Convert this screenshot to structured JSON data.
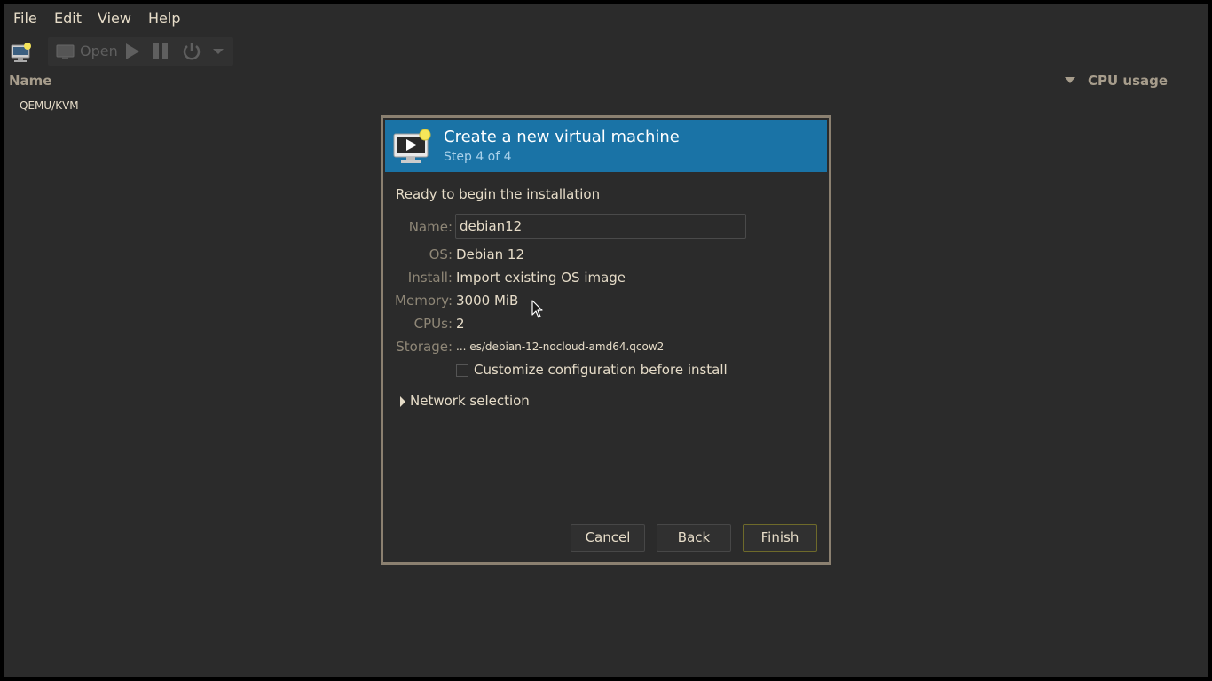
{
  "menubar": {
    "items": [
      "File",
      "Edit",
      "View",
      "Help"
    ]
  },
  "toolbar": {
    "new_vm_icon": "new-vm-icon",
    "open_label": "Open",
    "run_icon": "play-icon",
    "pause_icon": "pause-icon",
    "shutdown_icon": "power-icon",
    "menu_icon": "chevron-down-icon"
  },
  "vm_list": {
    "columns": [
      "Name",
      "CPU usage"
    ],
    "connections": [
      "QEMU/KVM"
    ]
  },
  "dialog": {
    "title": "Create a new virtual machine",
    "step": "Step 4 of 4",
    "ready_text": "Ready to begin the installation",
    "fields": {
      "name_label": "Name:",
      "name_value": "debian12",
      "os_label": "OS:",
      "os_value": "Debian 12",
      "install_label": "Install:",
      "install_value": "Import existing OS image",
      "memory_label": "Memory:",
      "memory_value": "3000 MiB",
      "cpus_label": "CPUs:",
      "cpus_value": "2",
      "storage_label": "Storage:",
      "storage_value": "... es/debian-12-nocloud-amd64.qcow2"
    },
    "customize_label": "Customize configuration before install",
    "customize_checked": false,
    "network_label": "Network selection",
    "buttons": {
      "cancel": "Cancel",
      "back": "Back",
      "finish": "Finish"
    }
  },
  "colors": {
    "header_blue": "#1a73a6",
    "background": "#2b2b2b",
    "text": "#e6dcc8",
    "label_muted": "#8f8777",
    "dialog_border": "#8b8070"
  }
}
